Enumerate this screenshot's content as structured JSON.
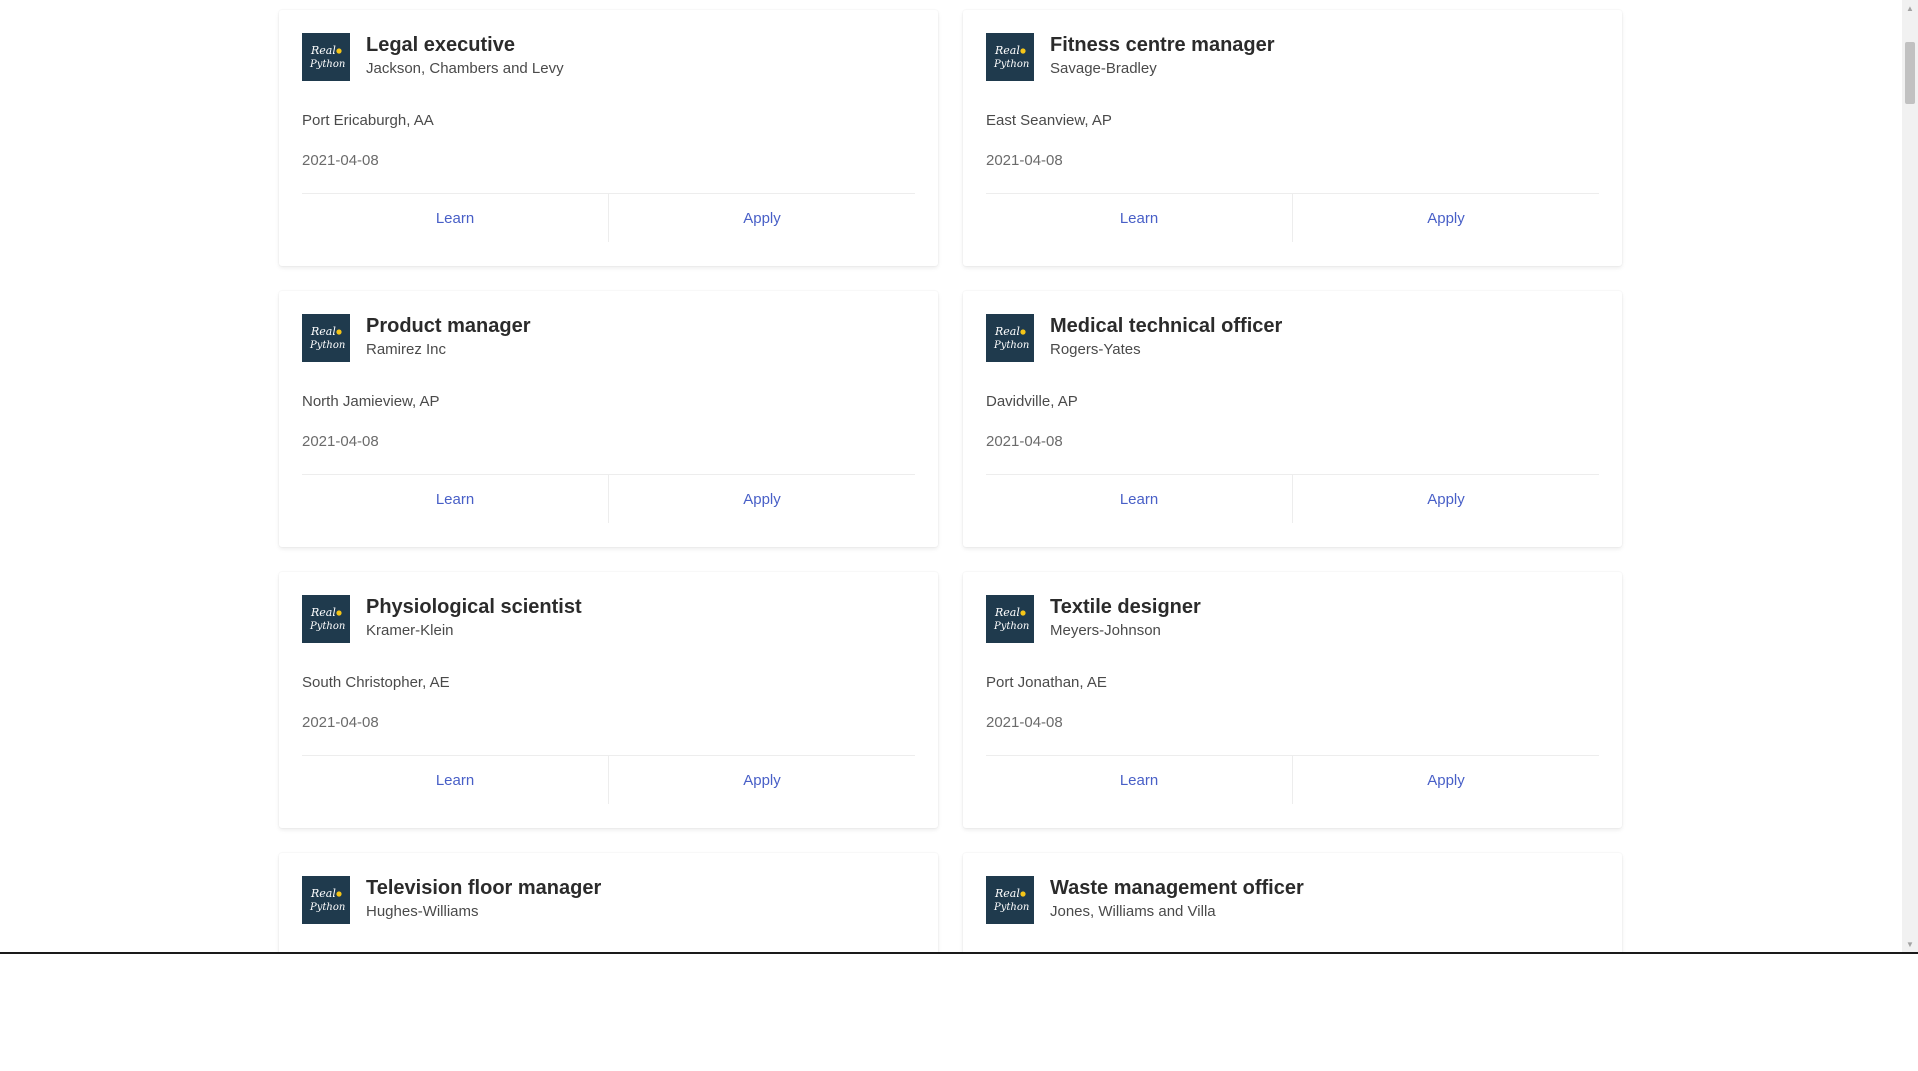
{
  "logo": {
    "line1": "Real",
    "line2": "Python",
    "bg": "#1f3a4d",
    "dot": "#f5c518",
    "icon": "real-python-logo"
  },
  "colors": {
    "link": "#485fc7"
  },
  "jobs": [
    {
      "title": "Legal executive",
      "company": "Jackson, Chambers and Levy",
      "location": "Port Ericaburgh, AA",
      "date": "2021-04-08",
      "learn": "Learn",
      "apply": "Apply"
    },
    {
      "title": "Fitness centre manager",
      "company": "Savage-Bradley",
      "location": "East Seanview, AP",
      "date": "2021-04-08",
      "learn": "Learn",
      "apply": "Apply"
    },
    {
      "title": "Product manager",
      "company": "Ramirez Inc",
      "location": "North Jamieview, AP",
      "date": "2021-04-08",
      "learn": "Learn",
      "apply": "Apply"
    },
    {
      "title": "Medical technical officer",
      "company": "Rogers-Yates",
      "location": "Davidville, AP",
      "date": "2021-04-08",
      "learn": "Learn",
      "apply": "Apply"
    },
    {
      "title": "Physiological scientist",
      "company": "Kramer-Klein",
      "location": "South Christopher, AE",
      "date": "2021-04-08",
      "learn": "Learn",
      "apply": "Apply"
    },
    {
      "title": "Textile designer",
      "company": "Meyers-Johnson",
      "location": "Port Jonathan, AE",
      "date": "2021-04-08",
      "learn": "Learn",
      "apply": "Apply"
    },
    {
      "title": "Television floor manager",
      "company": "Hughes-Williams"
    },
    {
      "title": "Waste management officer",
      "company": "Jones, Williams and Villa"
    }
  ],
  "scrollbar": {
    "up": "▲",
    "down": "▼"
  }
}
